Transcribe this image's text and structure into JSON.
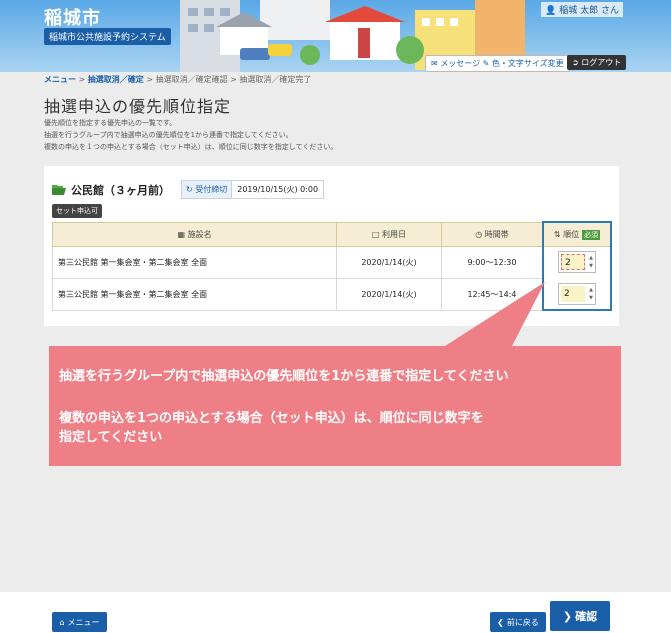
{
  "header": {
    "city_name": "稲城市",
    "system_name": "稲城市公共施設予約システム",
    "user_name": "稲城 太郎 さん",
    "message_label": "メッセージ",
    "display_label": "色・文字サイズ変更",
    "logout_label": "ログアウト"
  },
  "breadcrumb": [
    {
      "label": "メニュー",
      "done": true
    },
    {
      "label": "抽選取消／確定",
      "done": true
    },
    {
      "label": "抽選取消／確定確認",
      "done": false
    },
    {
      "label": "抽選取消／確定完了",
      "done": false
    }
  ],
  "page": {
    "title": "抽選申込の優先順位指定",
    "desc1": "優先順位を指定する優先申込の一覧です。",
    "desc2": "抽選を行うグループ内で抽選申込の優先順位を1から連番で指定してください。",
    "desc3": "複数の申込を１つの申込とする場合（セット申込）は、順位に同じ数字を指定してください。"
  },
  "facility": {
    "name": "公民館（３ヶ月前）",
    "deadline_label": "受付締切",
    "deadline_value": "2019/10/15(火) 0:00",
    "set_badge": "セット申込可"
  },
  "table": {
    "headers": {
      "name": "施設名",
      "date": "利用日",
      "time": "時間帯",
      "order": "順位",
      "required": "必須"
    },
    "rows": [
      {
        "name": "第三公民館 第一集会室・第二集会室 全面",
        "date": "2020/1/14(火)",
        "time": "9:00～12:30",
        "order": "2"
      },
      {
        "name": "第三公民館 第一集会室・第二集会室 全面",
        "date": "2020/1/14(火)",
        "time": "12:45～14:4",
        "order": "2"
      }
    ]
  },
  "callout": {
    "line1": "抽選を行うグループ内で抽選申込の優先順位を1から連番で指定してください",
    "line2": "複数の申込を1つの申込とする場合（セット申込）は、順位に同じ数字を",
    "line3": "指定してください"
  },
  "footer": {
    "menu_label": "メニュー",
    "back_label": "前に戻る",
    "confirm_label": "確認"
  },
  "colors": {
    "accent": "#1b5ea8",
    "callout": "#ef7f86",
    "header_bg": "#5aa8e6"
  }
}
